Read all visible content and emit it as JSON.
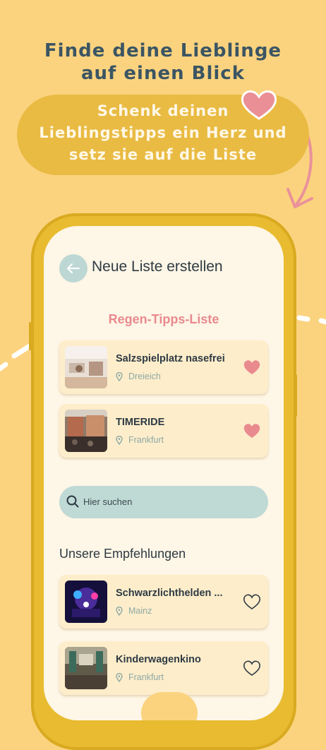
{
  "promo": {
    "headline_line1": "Finde deine Lieblinge",
    "headline_line2": "auf einen Blick",
    "bubble_line1": "Schenk deinen",
    "bubble_line2": "Lieblingstipps ein Herz und",
    "bubble_line3": "setz sie auf die Liste"
  },
  "header": {
    "title": "Neue Liste erstellen",
    "back_icon": "arrow-left-icon"
  },
  "list": {
    "name": "Regen-Tipps-Liste",
    "items": [
      {
        "title": "Salzspielplatz nasefrei",
        "location": "Dreieich",
        "favorite": true
      },
      {
        "title": "TIMERIDE",
        "location": "Frankfurt",
        "favorite": true
      }
    ]
  },
  "search": {
    "placeholder": "Hier suchen"
  },
  "recommendations": {
    "title": "Unsere Empfehlungen",
    "items": [
      {
        "title": "Schwarzlichthelden ...",
        "location": "Mainz",
        "favorite": false
      },
      {
        "title": "Kinderwagenkino",
        "location": "Frankfurt",
        "favorite": false
      }
    ]
  },
  "colors": {
    "background": "#fbd37f",
    "accent_pink": "#e98a8f",
    "text_dark": "#2e3a44",
    "teal": "#bfd9d5"
  }
}
